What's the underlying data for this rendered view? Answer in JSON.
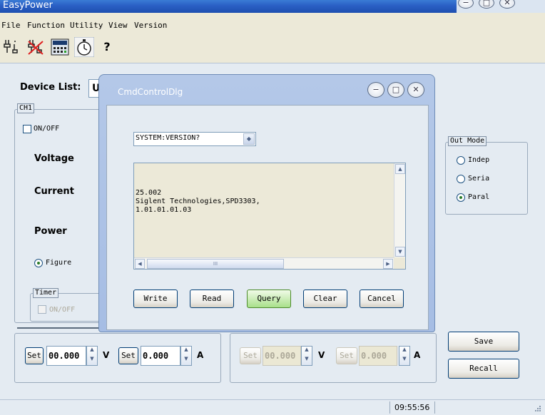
{
  "app": {
    "title": "EasyPower"
  },
  "window_controls": {
    "minimize": "−",
    "maximize": "□",
    "close": "✕"
  },
  "menu": {
    "items": [
      "File",
      "Function",
      "Utility",
      "View",
      "Version"
    ]
  },
  "toolbar": {
    "help": "?"
  },
  "device": {
    "label": "Device List:",
    "value": "U"
  },
  "ch1": {
    "group_label": "CH1",
    "onoff_label": "ON/OFF",
    "voltage_label": "Voltage",
    "current_label": "Current",
    "power_label": "Power",
    "figure_label": "Figure",
    "timer_label": "Timer",
    "timer_onoff_label": "ON/OFF",
    "set_label": "Set",
    "voltage_value": "00.000",
    "voltage_unit": "V",
    "current_value": "0.000",
    "current_unit": "A"
  },
  "ch2": {
    "set_label": "Set",
    "voltage_value": "00.000",
    "voltage_unit": "V",
    "current_value": "0.000",
    "current_unit": "A"
  },
  "out_mode": {
    "label": "Out Mode",
    "options": [
      "Indep",
      "Seria",
      "Paral"
    ],
    "selected": "Paral"
  },
  "actions": {
    "save": "Save",
    "recall": "Recall"
  },
  "status": {
    "time": "09:55:56"
  },
  "dialog": {
    "title": "CmdControlDlg",
    "command": "SYSTEM:VERSION?",
    "response": "25.002\nSiglent Technologies,SPD3303,\n1.01.01.01.03",
    "buttons": {
      "write": "Write",
      "read": "Read",
      "query": "Query",
      "clear": "Clear",
      "cancel": "Cancel"
    },
    "scroll_thumb": "III"
  },
  "colors": {
    "titlebar": "#2a5fc4",
    "client_bg": "#e4ebf2",
    "dialog_frame": "#a6bde4",
    "response_bg": "#ece9d8",
    "query_highlight": "#a8e08a"
  }
}
